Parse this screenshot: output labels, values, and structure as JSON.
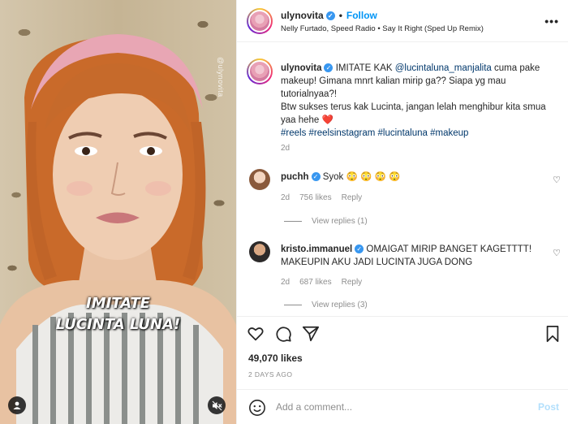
{
  "media": {
    "watermark": "@ulynovita",
    "overlay_line1": "IMITATE",
    "overlay_line2": "LUCINTA LUNA!"
  },
  "header": {
    "username": "ulynovita",
    "follow_label": "Follow",
    "audio": "Nelly Furtado, Speed Radio • Say It Right (Sped Up Remix)",
    "more": "•••"
  },
  "caption": {
    "username": "ulynovita",
    "text_before": "IMITATE KAK ",
    "mention": "@lucintaluna_manjalita",
    "text_after": " cuma pake makeup! Gimana mnrt kalian mirip ga?? Siapa yg mau tutorialnyaa?!",
    "line2": "Btw sukses terus kak Lucinta, jangan lelah menghibur kita smua yaa hehe ",
    "heart": "❤️",
    "hashtags": "#reels #reelsinstagram #lucintaluna #makeup",
    "time": "2d"
  },
  "comments": [
    {
      "username": "puchh",
      "text": "Syok 😳 😳 😳 😳",
      "time": "2d",
      "likes": "756 likes",
      "reply": "Reply",
      "view_replies": "View replies (1)"
    },
    {
      "username": "kristo.immanuel",
      "text": "OMAIGAT MIRIP BANGET KAGETTTT! MAKEUPIN AKU JADI LUCINTA JUGA DONG",
      "time": "2d",
      "likes": "687 likes",
      "reply": "Reply",
      "view_replies": "View replies (3)"
    }
  ],
  "actions": {
    "likes": "49,070 likes",
    "date": "2 DAYS AGO"
  },
  "add_comment": {
    "placeholder": "Add a comment...",
    "post_label": "Post"
  },
  "colors": {
    "accent": "#0095f6",
    "post_disabled": "#b2dffc",
    "muted": "#8e8e8e",
    "verified": "#3897f0"
  }
}
